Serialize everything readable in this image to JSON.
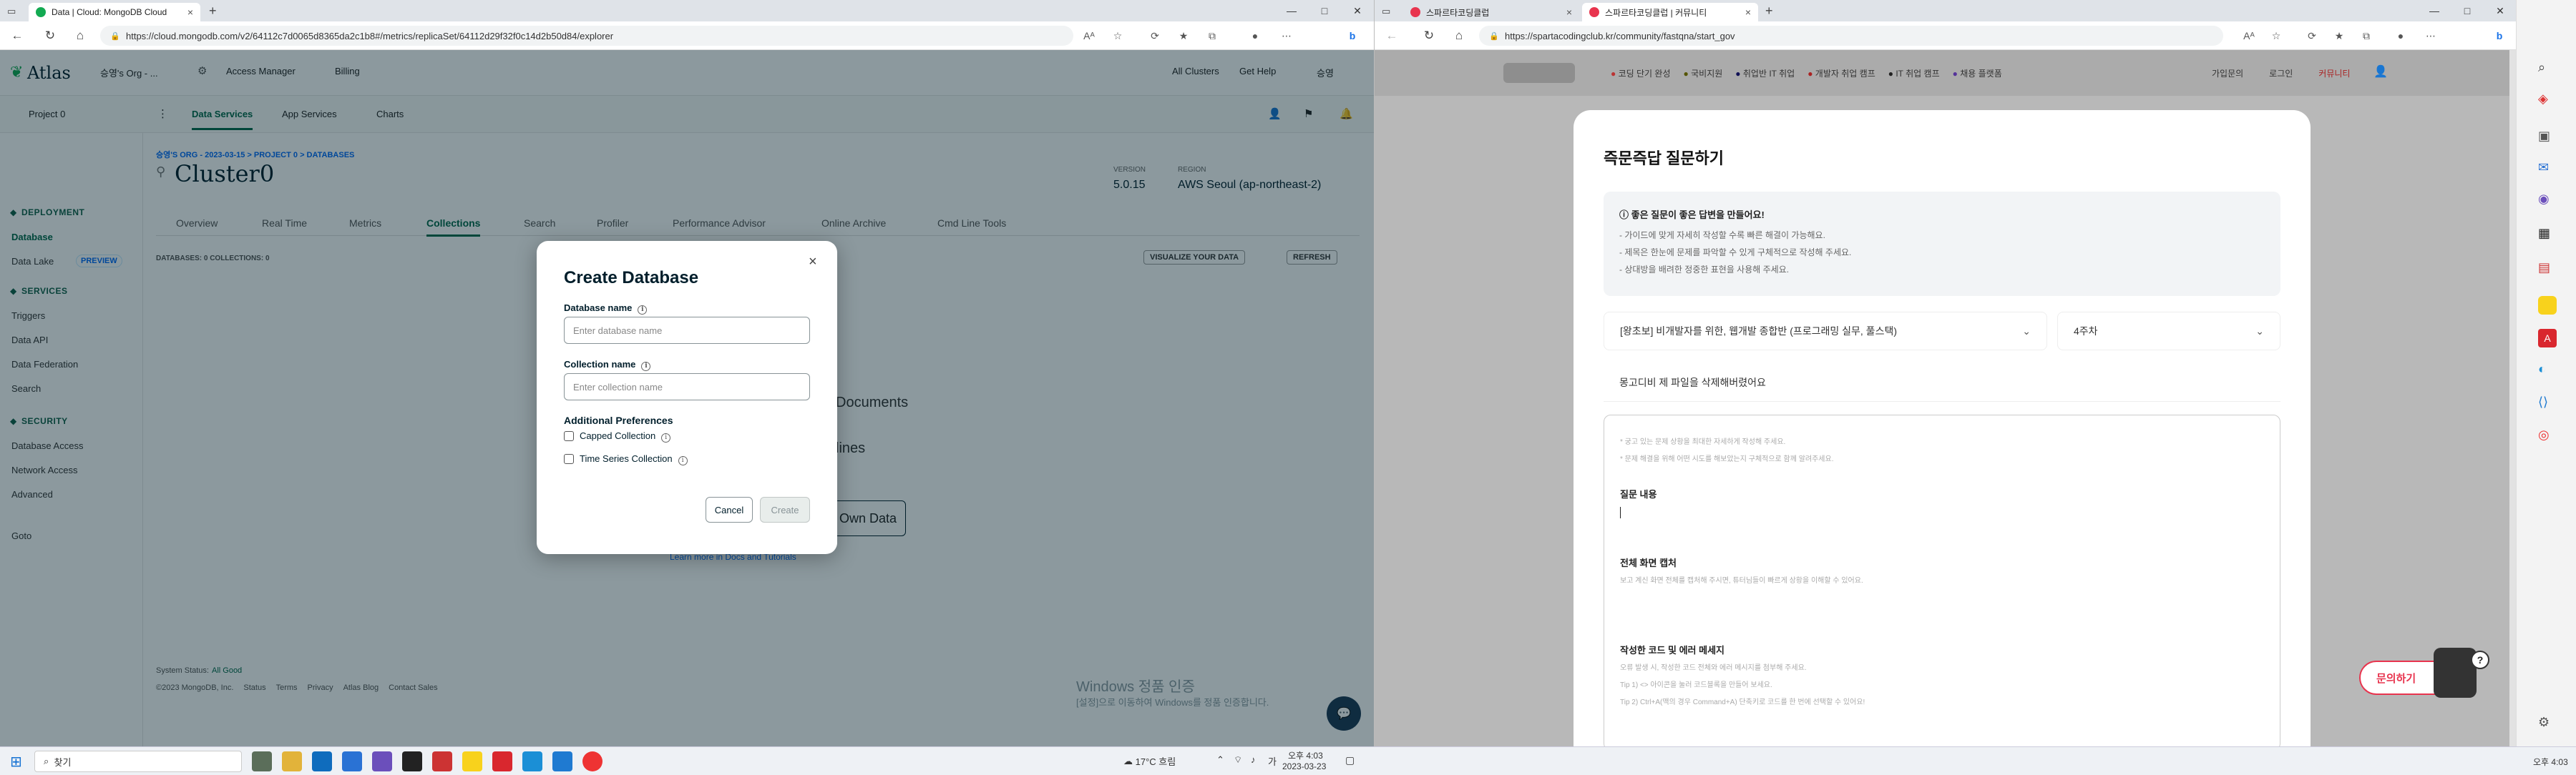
{
  "left_browser": {
    "tab_title": "Data | Cloud: MongoDB Cloud",
    "tab_close": "×",
    "new_tab": "+",
    "url": "https://cloud.mongodb.com/v2/64112c7d0065d8365da2c1b8#/metrics/replicaSet/64112d29f32f0c14d2b50d84/explorer",
    "win_min": "—",
    "win_max": "□",
    "win_close": "✕"
  },
  "mongo": {
    "logo": "Atlas",
    "org": "승영's Org - ...",
    "access_manager": "Access Manager",
    "billing": "Billing",
    "all_clusters": "All Clusters",
    "get_help": "Get Help",
    "user": "승영",
    "project": "Project 0",
    "nav": [
      "Data Services",
      "App Services",
      "Charts"
    ],
    "sidebar": {
      "deployment": "DEPLOYMENT",
      "database": "Database",
      "data_lake": "Data Lake",
      "preview": "PREVIEW",
      "services": "SERVICES",
      "triggers": "Triggers",
      "data_api": "Data API",
      "data_federation": "Data Federation",
      "search": "Search",
      "security": "SECURITY",
      "database_access": "Database Access",
      "network_access": "Network Access",
      "advanced": "Advanced",
      "goto": "Goto"
    },
    "breadcrumb": "승영'S ORG - 2023-03-15 > PROJECT 0 > DATABASES",
    "cluster_name": "Cluster0",
    "version_label": "VERSION",
    "version": "5.0.15",
    "region_label": "REGION",
    "region": "AWS Seoul (ap-northeast-2)",
    "tabs": [
      "Overview",
      "Real Time",
      "Metrics",
      "Collections",
      "Search",
      "Profiler",
      "Performance Advisor",
      "Online Archive",
      "Cmd Line Tools"
    ],
    "db_counts": "DATABASES: 0   COLLECTIONS: 0",
    "visualize": "VISUALIZE YOUR DATA",
    "refresh": "REFRESH",
    "bg_documents": "Documents",
    "bg_lines": "lines",
    "bg_own_data": "Own Data",
    "bg_learn_more": "Learn more in Docs and Tutorials",
    "footer_status_label": "System Status:",
    "footer_status": "All Good",
    "footer_copy": "©2023 MongoDB, Inc.",
    "footer_links": [
      "Status",
      "Terms",
      "Privacy",
      "Atlas Blog",
      "Contact Sales"
    ],
    "watermark1": "Windows 정품 인증",
    "watermark2": "[설정]으로 이동하여 Windows를 정품 인증합니다."
  },
  "modal": {
    "title": "Create Database",
    "close": "×",
    "db_name_label": "Database name",
    "db_name_placeholder": "Enter database name",
    "coll_name_label": "Collection name",
    "coll_name_placeholder": "Enter collection name",
    "additional": "Additional Preferences",
    "capped": "Capped Collection",
    "timeseries": "Time Series Collection",
    "cancel": "Cancel",
    "create": "Create"
  },
  "right_browser": {
    "tab1": "스파르타코딩클럽",
    "tab2": "스파르타코딩클럽 | 커뮤니티",
    "tab_close": "×",
    "new_tab": "+",
    "url": "https://spartacodingclub.kr/community/fastqna/start_gov",
    "win_min": "—",
    "win_max": "□",
    "win_close": "✕"
  },
  "sparta": {
    "nav": [
      "코딩 단기 완성",
      "국비지원",
      "취업반 IT 취업",
      "개발자 취업 캠프",
      "IT 취업 캠프",
      "채용 플랫폼"
    ],
    "right_nav": [
      "가입문의",
      "로그인",
      "커뮤니티"
    ],
    "title": "즉문즉답 질문하기",
    "tip_title": "좋은 질문이 좋은 답변을 만들어요!",
    "tips": [
      "- 가이드에 맞게 자세히 작성할 수록 빠른 해결이 가능해요.",
      "- 제목은 한눈에 문제를 파악할 수 있게 구체적으로 작성해 주세요.",
      "- 상대방을 배려한 정중한 표현을 사용해 주세요."
    ],
    "course": "[왕초보] 비개발자를 위한, 웹개발 종합반 (프로그래밍 실무, 풀스택)",
    "week": "4주차",
    "question_title": "몽고디비 제 파일을 삭제해버렸어요",
    "hint1": "* 궁고 있는 문제 상황을 최대한 자세하게 작성해 주세요.",
    "hint2": "* 문제 해결을 위해 어떤 시도를 해보았는지 구체적으로 함께 알려주세요.",
    "sec1": "질문 내용",
    "sec2": "전체 화면 캡처",
    "sec2_hint": "보고 계신 화면 전체를 캡처해 주시면, 튜터님들이 빠르게 상황을 이해할 수 있어요.",
    "sec3": "작성한 코드 및 에러 메세지",
    "sec3_hint1": "오류 발생 시, 작성한 코드 전체와 에러 메시지를 첨부해 주세요.",
    "sec3_hint2": "Tip 1) <> 아이콘을 눌러 코드블록을 만들어 보세요.",
    "sec3_hint3": "Tip 2) Ctrl+A(맥의 경우 Command+A) 단축키로 코드를 한 번에 선택할 수 있어요!",
    "ask_button": "문의하기"
  },
  "taskbar": {
    "search": "찾기",
    "weather": "17°C 흐림",
    "time": "오후 4:03",
    "date": "2023-03-23",
    "ime": "가",
    "corner_time": "오후 4:03"
  }
}
